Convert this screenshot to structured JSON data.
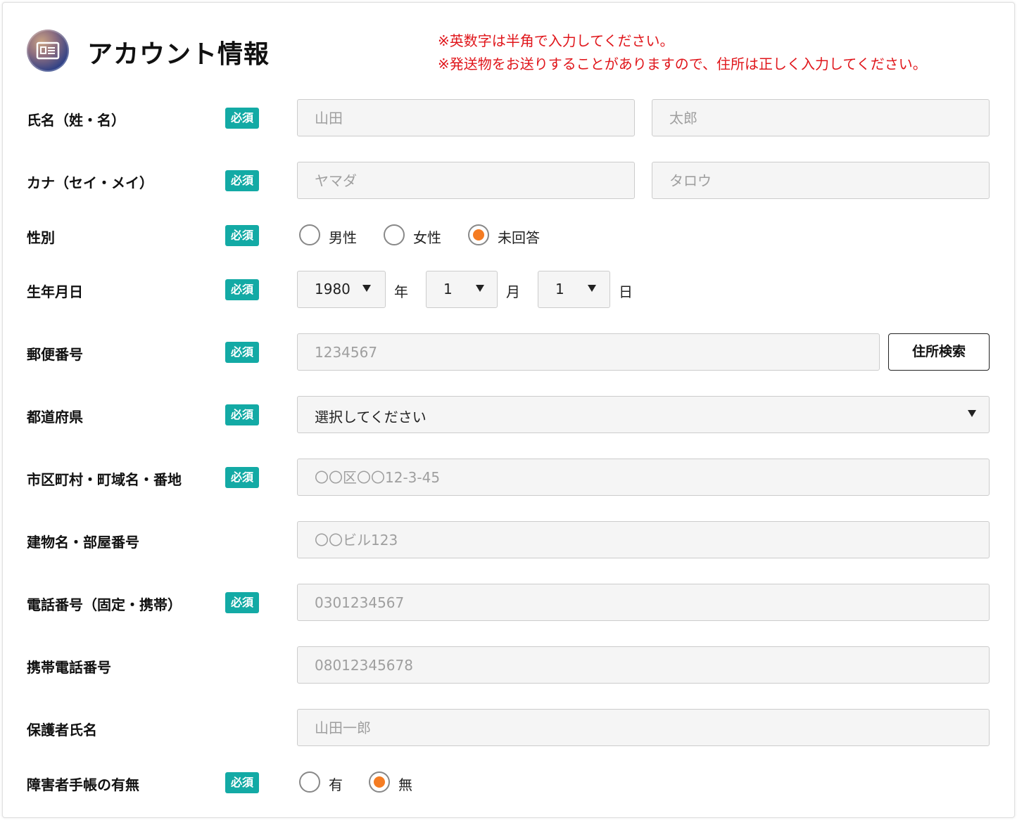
{
  "header": {
    "title": "アカウント情報",
    "icon": "id-card-icon",
    "notices": [
      "※英数字は半角で入力してください。",
      "※発送物をお送りすることがありますので、住所は正しく入力してください。"
    ]
  },
  "required_badge": "必須",
  "colors": {
    "badge": "#13aaa5",
    "notice": "#e0161b",
    "radio_selected": "#f57c22"
  },
  "fields": {
    "name": {
      "label": "氏名（姓・名）",
      "last_placeholder": "山田",
      "first_placeholder": "太郎"
    },
    "kana": {
      "label": "カナ（セイ・メイ）",
      "last_placeholder": "ヤマダ",
      "first_placeholder": "タロウ"
    },
    "gender": {
      "label": "性別",
      "options": [
        "男性",
        "女性",
        "未回答"
      ],
      "selected": "未回答"
    },
    "birthday": {
      "label": "生年月日",
      "year": "1980",
      "year_unit": "年",
      "month": "1",
      "month_unit": "月",
      "day": "1",
      "day_unit": "日"
    },
    "postal": {
      "label": "郵便番号",
      "placeholder": "1234567",
      "button": "住所検索"
    },
    "prefecture": {
      "label": "都道府県",
      "value": "選択してください"
    },
    "city": {
      "label": "市区町村・町域名・番地",
      "placeholder": "〇〇区〇〇12-3-45"
    },
    "building": {
      "label": "建物名・部屋番号",
      "placeholder": "〇〇ビル123"
    },
    "phone": {
      "label": "電話番号（固定・携帯）",
      "placeholder": "0301234567"
    },
    "mobile": {
      "label": "携帯電話番号",
      "placeholder": "08012345678"
    },
    "guardian": {
      "label": "保護者氏名",
      "placeholder": "山田一郎"
    },
    "disability": {
      "label": "障害者手帳の有無",
      "options": [
        "有",
        "無"
      ],
      "selected": "無"
    }
  }
}
